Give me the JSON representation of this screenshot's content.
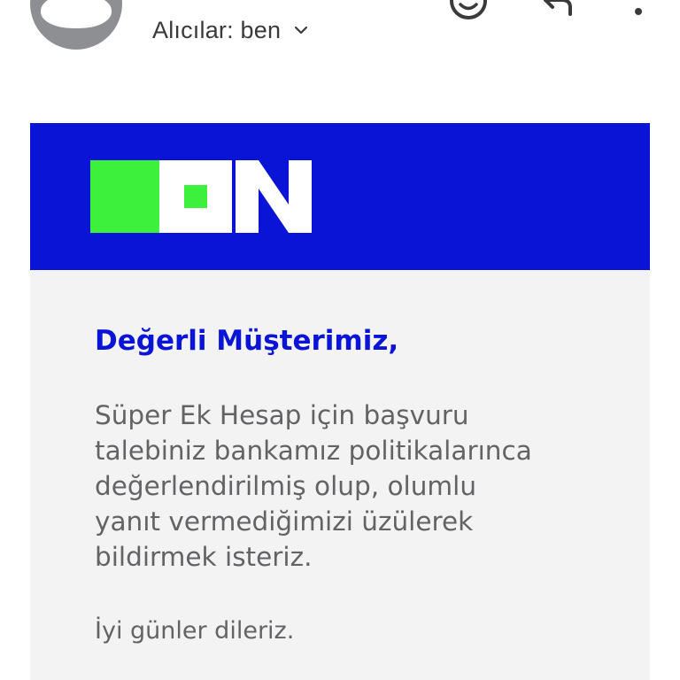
{
  "header": {
    "recipients_label": "Alıcılar: ben",
    "icons": {
      "emoji": "smiley-icon",
      "reply": "reply-icon",
      "more": "more-vertical-icon",
      "expand": "chevron-down-icon"
    }
  },
  "email": {
    "logo_text": "ON",
    "greeting": "Değerli Müşterimiz,",
    "body_lines": [
      "Süper Ek Hesap için başvuru",
      "talebiniz bankamız politikalarınca",
      "değerlendirilmiş olup, olumlu",
      "yanıt vermediğimizi üzülerek",
      "bildirmek isteriz."
    ],
    "closing": "İyi günler dileriz."
  },
  "colors": {
    "brand_blue": "#0a14d6",
    "brand_green": "#3cf03c",
    "background": "#f3f3f4",
    "text": "#636366"
  }
}
